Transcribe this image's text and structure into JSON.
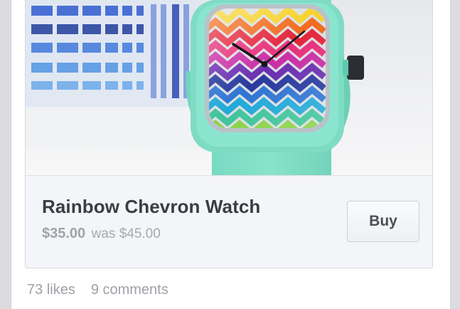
{
  "product": {
    "image_alt": "Rainbow chevron watch with mint strap",
    "title": "Rainbow Chevron Watch",
    "price": "$35.00",
    "was_price": "was $45.00",
    "buy_label": "Buy"
  },
  "stats": {
    "likes": "73 likes",
    "comments": "9 comments"
  },
  "colors": {
    "accent_strap": "#7fdcc4",
    "card_bg": "#f4f5f8",
    "title_text": "#3a3d44",
    "muted_text": "#9fa1a8"
  }
}
